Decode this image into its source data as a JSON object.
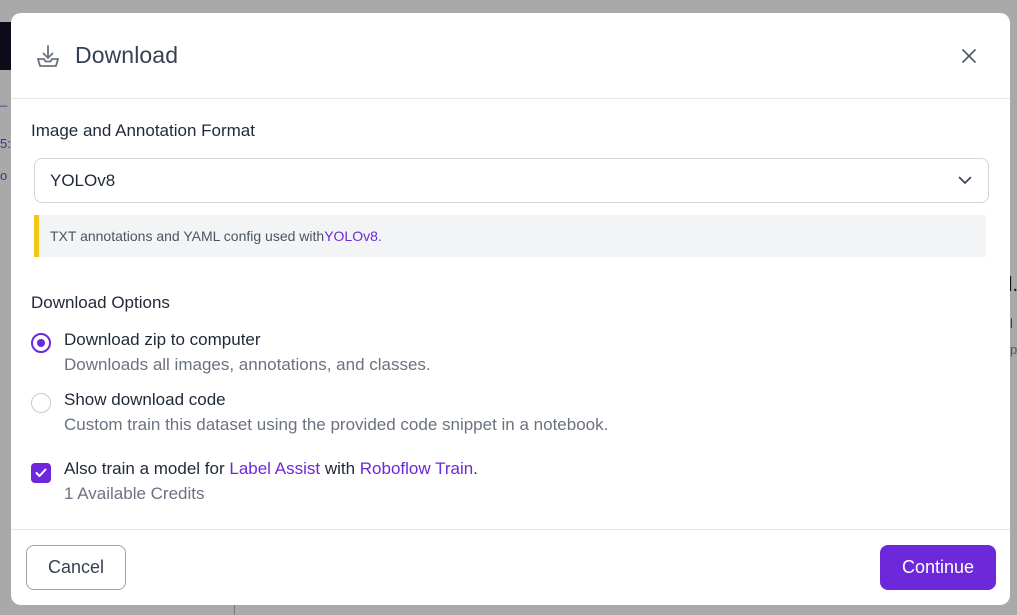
{
  "background": {
    "fragments": [
      "_",
      "5:",
      "o",
      "l.",
      "l",
      "p"
    ]
  },
  "dialog": {
    "title": "Download",
    "header_icon": "download-icon",
    "close_icon": "close-icon"
  },
  "format": {
    "label": "Image and Annotation Format",
    "selected": "YOLOv8",
    "chevron_icon": "chevron-down-icon",
    "info_prefix": "TXT annotations and YAML config used with ",
    "info_link": "YOLOv8",
    "info_suffix": "."
  },
  "options": {
    "label": "Download Options",
    "zip": {
      "title": "Download zip to computer",
      "description": "Downloads all images, annotations, and classes.",
      "selected": true
    },
    "code": {
      "title": "Show download code",
      "description": "Custom train this dataset using the provided code snippet in a notebook.",
      "selected": false
    },
    "train": {
      "prefix": "Also train a model for ",
      "link1": "Label Assist",
      "middle": " with ",
      "link2": "Roboflow Train",
      "suffix": ".",
      "credits": "1 Available Credits",
      "checked": true
    }
  },
  "footer": {
    "cancel_label": "Cancel",
    "continue_label": "Continue"
  },
  "colors": {
    "accent": "#6d28d9",
    "info_border": "#f5c518",
    "overlay": "#a9a9a9"
  }
}
